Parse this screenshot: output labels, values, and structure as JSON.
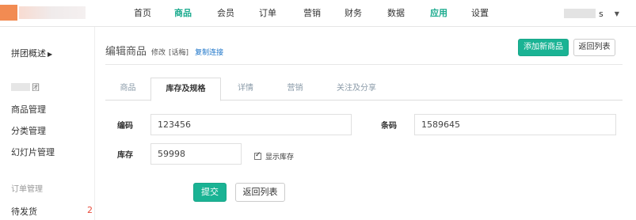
{
  "nav": {
    "items": [
      {
        "label": "首页",
        "active": false
      },
      {
        "label": "商品",
        "active": true
      },
      {
        "label": "会员",
        "active": false
      },
      {
        "label": "订单",
        "active": false
      },
      {
        "label": "营销",
        "active": false
      },
      {
        "label": "财务",
        "active": false
      },
      {
        "label": "数据",
        "active": false
      },
      {
        "label": "应用",
        "active": true
      },
      {
        "label": "设置",
        "active": false
      }
    ],
    "user_suffix": "s"
  },
  "sidebar": {
    "head": "拼团概述",
    "group_suffix": "团",
    "items": [
      "商品管理",
      "分类管理",
      "幻灯片管理"
    ],
    "section": "订单管理",
    "pending_label": "待发货",
    "pending_count": "2"
  },
  "main": {
    "title": "编辑商品",
    "mode": "修改",
    "name": "[话梅]",
    "copy_link": "复制连接",
    "add_button": "添加新商品",
    "back_button": "返回列表",
    "tabs": [
      {
        "label": "商品",
        "active": false
      },
      {
        "label": "库存及规格",
        "active": true
      },
      {
        "label": "详情",
        "active": false
      },
      {
        "label": "营销",
        "active": false
      },
      {
        "label": "关注及分享",
        "active": false
      }
    ],
    "form": {
      "code_label": "编码",
      "code_value": "123456",
      "barcode_label": "条码",
      "barcode_value": "1589645",
      "stock_label": "库存",
      "stock_value": "59998",
      "show_stock_label": "显示库存",
      "show_stock_checked": true,
      "submit_button": "提交",
      "back_button": "返回列表"
    }
  }
}
